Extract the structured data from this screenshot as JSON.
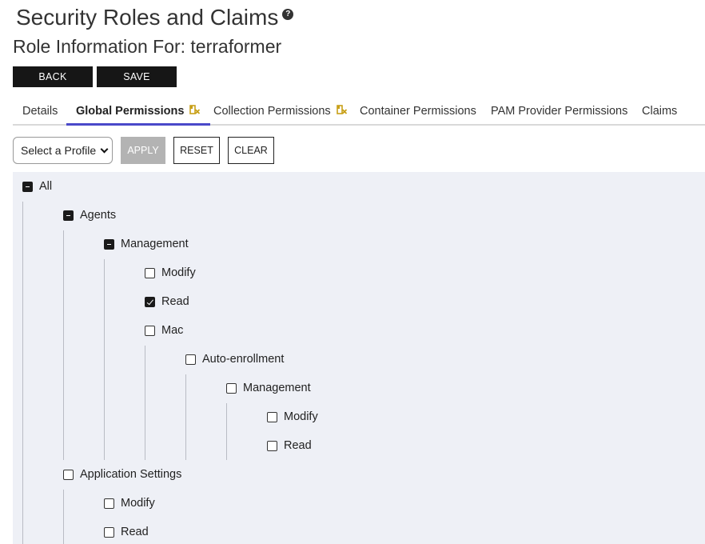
{
  "header": {
    "title": "Security Roles and Claims",
    "help_icon": "question-circle-icon",
    "subtitle": "Role Information For: terraformer"
  },
  "actions": {
    "back_label": "BACK",
    "save_label": "SAVE"
  },
  "tabs": [
    {
      "label": "Details",
      "active": false
    },
    {
      "label": "Global Permissions",
      "active": true,
      "icon": "permission-badge-icon"
    },
    {
      "label": "Collection Permissions",
      "active": false,
      "icon": "permission-badge-icon"
    },
    {
      "label": "Container Permissions",
      "active": false
    },
    {
      "label": "PAM Provider Permissions",
      "active": false
    },
    {
      "label": "Claims",
      "active": false
    }
  ],
  "toolbar": {
    "profile_select_value": "Select a Profile",
    "apply_label": "APPLY",
    "reset_label": "RESET",
    "clear_label": "CLEAR"
  },
  "tree": [
    {
      "label": "All",
      "state": "partial"
    },
    {
      "label": "Agents",
      "state": "partial"
    },
    {
      "label": "Management",
      "state": "partial"
    },
    {
      "label": "Modify",
      "state": "unchecked"
    },
    {
      "label": "Read",
      "state": "checked"
    },
    {
      "label": "Mac",
      "state": "unchecked"
    },
    {
      "label": "Auto-enrollment",
      "state": "unchecked"
    },
    {
      "label": "Management",
      "state": "unchecked"
    },
    {
      "label": "Modify",
      "state": "unchecked"
    },
    {
      "label": "Read",
      "state": "unchecked"
    },
    {
      "label": "Application Settings",
      "state": "unchecked"
    },
    {
      "label": "Modify",
      "state": "unchecked"
    },
    {
      "label": "Read",
      "state": "unchecked"
    }
  ],
  "colors": {
    "accent": "#4a49c9",
    "dark_button": "#161616",
    "tree_background": "#eef0f6",
    "tab_icon": "#c8a018"
  }
}
